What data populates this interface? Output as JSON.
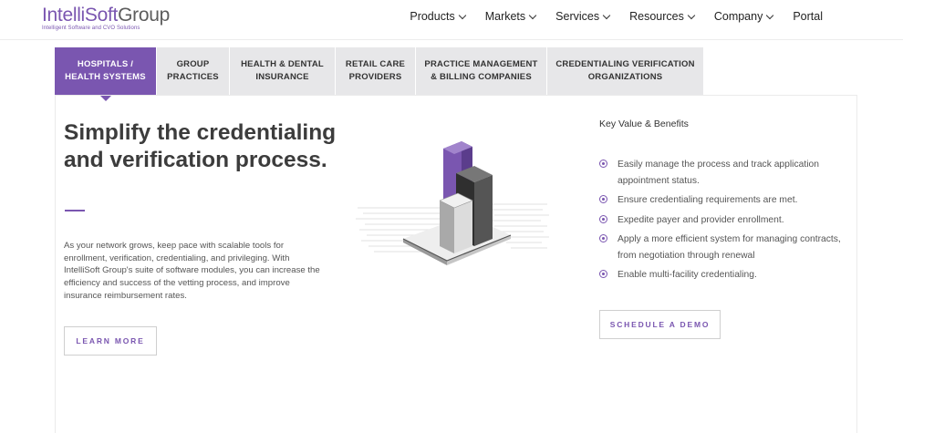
{
  "brand": {
    "logo_part1": "IntelliSoft",
    "logo_part2": "Group",
    "tagline": "Intelligent Software and CVO Solutions",
    "accent_color": "#7a56b0"
  },
  "nav": {
    "items": [
      {
        "label": "Products",
        "dropdown": true
      },
      {
        "label": "Markets",
        "dropdown": true
      },
      {
        "label": "Services",
        "dropdown": true
      },
      {
        "label": "Resources",
        "dropdown": true
      },
      {
        "label": "Company",
        "dropdown": true
      },
      {
        "label": "Portal",
        "dropdown": false
      }
    ]
  },
  "tabs": [
    {
      "line1": "HOSPITALS /",
      "line2": "HEALTH SYSTEMS",
      "active": true
    },
    {
      "line1": "GROUP",
      "line2": "PRACTICES",
      "active": false
    },
    {
      "line1": "HEALTH & DENTAL",
      "line2": "INSURANCE",
      "active": false
    },
    {
      "line1": "RETAIL CARE",
      "line2": "PROVIDERS",
      "active": false
    },
    {
      "line1": "PRACTICE MANAGEMENT",
      "line2": "& BILLING COMPANIES",
      "active": false
    },
    {
      "line1": "CREDENTIALING VERIFICATION",
      "line2": "ORGANIZATIONS",
      "active": false
    }
  ],
  "hero": {
    "title": "Simplify the credentialing and verification process.",
    "paragraph": "As your network grows, keep pace with scalable tools for enrollment, verification, credentialing, and privileging. With IntelliSoft Group's suite of software modules, you can increase the efficiency and success of the vetting process, and improve insurance reimbursement rates.",
    "learn_more_label": "LEARN MORE"
  },
  "benefits": {
    "title": "Key Value & Benefits",
    "items": [
      "Easily manage the process and track application appointment status.",
      "Ensure credentialing requirements are met.",
      "Expedite payer and provider enrollment.",
      "Apply a more efficient system for managing contracts, from negotiation through renewal",
      "Enable multi-facility credentialing."
    ],
    "demo_label": "SCHEDULE A DEMO"
  },
  "illustration": {
    "icon": "bar-chart-isometric-icon"
  }
}
